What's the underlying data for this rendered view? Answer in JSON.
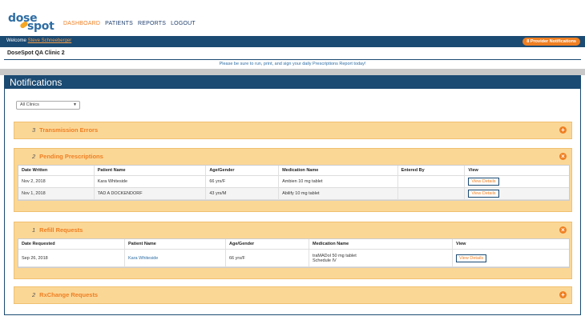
{
  "header": {
    "logo_part1": "dose",
    "logo_part2": "spot",
    "nav": [
      "DASHBOARD",
      "PATIENTS",
      "REPORTS",
      "LOGOUT"
    ]
  },
  "bar": {
    "welcome_prefix": "Welcome ",
    "user_name": "Steve Schneeberger",
    "notifications_badge": "8 Provider Notifications"
  },
  "clinic_name": "DoseSpot QA Clinic 2",
  "reminder": "Please be sure to run, print, and sign your daily Prescriptions Report today!",
  "panel": {
    "title": "Notifications",
    "clinic_filter": "All Clinics"
  },
  "sections": {
    "transmission": {
      "count": "3",
      "title": "Transmission Errors"
    },
    "pending": {
      "count": "2",
      "title": "Pending Prescriptions",
      "headers": [
        "Date Written",
        "Patient Name",
        "Age/Gender",
        "Medication Name",
        "Entered By",
        "View"
      ],
      "rows": [
        {
          "date": "Nov 2, 2018",
          "patient": "Kara Whiteside",
          "age": "66 yrs/F",
          "med": "Ambien 10 mg tablet",
          "entered": "",
          "view": "View Details"
        },
        {
          "date": "Nov 1, 2018",
          "patient": "TAD A DOCKENDORF",
          "age": "43 yrs/M",
          "med": "Abilify 10 mg tablet",
          "entered": "",
          "view": "View Details"
        }
      ]
    },
    "refill": {
      "count": "1",
      "title": "Refill Requests",
      "headers": [
        "Date Requested",
        "Patient Name",
        "Age/Gender",
        "Medication Name",
        "View"
      ],
      "rows": [
        {
          "date": "Sep 26, 2018",
          "patient": "Kara Whiteside",
          "age": "66 yrs/F",
          "med_line1": "traMADol 50 mg tablet",
          "med_line2": "Schedule IV",
          "view": "View Details"
        }
      ]
    },
    "rxchange": {
      "count": "2",
      "title": "RxChange Requests"
    }
  },
  "icons": {
    "expand": "plus-circle-icon",
    "collapse": "close-circle-icon"
  },
  "colors": {
    "brand_blue": "#1b4a72",
    "accent_orange": "#ef7f22",
    "section_bg": "#fbd796"
  }
}
